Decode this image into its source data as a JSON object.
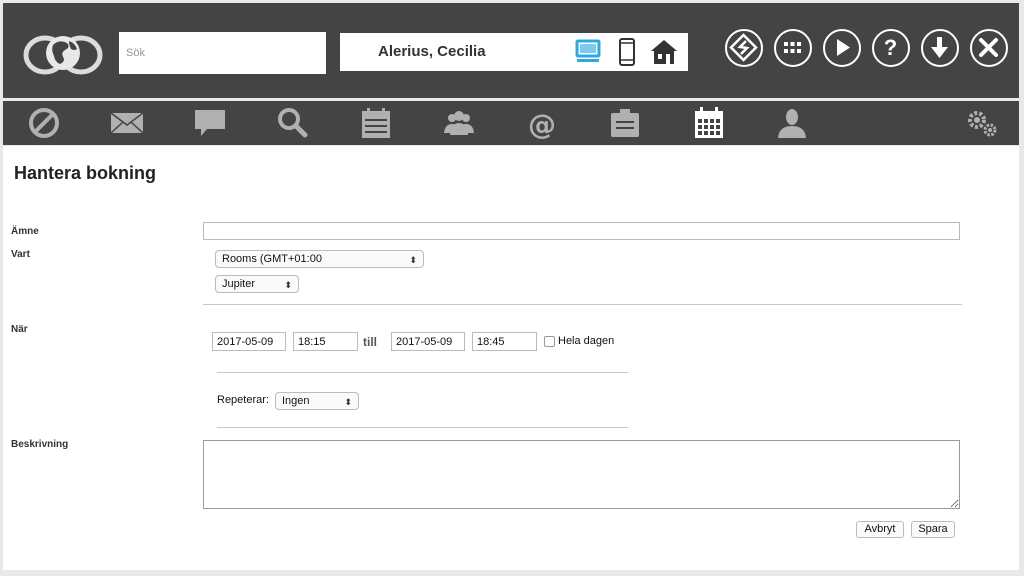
{
  "header": {
    "search_placeholder": "Sök",
    "user_name": "Alerius, Cecilia",
    "device_icons": [
      "desktop-icon",
      "phone-icon",
      "home-icon"
    ],
    "action_buttons": [
      "switch-icon",
      "apps-grid-icon",
      "play-icon",
      "help-icon",
      "download-icon",
      "close-icon"
    ]
  },
  "nav": {
    "items": [
      "block-icon",
      "mail-icon",
      "chat-icon",
      "search-icon",
      "calendar-list-icon",
      "group-icon",
      "at-icon",
      "clipboard-icon",
      "calendar-grid-icon",
      "person-icon",
      "settings-icon"
    ],
    "active": "calendar-grid-icon"
  },
  "form": {
    "title": "Hantera bokning",
    "subject_label": "Ämne",
    "subject_value": "",
    "where_label": "Vart",
    "location_select": "Rooms (GMT+01:00",
    "room_select": "Jupiter",
    "when_label": "När",
    "start_date": "2017-05-09",
    "start_time": "18:15",
    "till_label": "till",
    "end_date": "2017-05-09",
    "end_time": "18:45",
    "all_day_label": "Hela dagen",
    "all_day_checked": false,
    "repeat_label": "Repeterar:",
    "repeat_value": "Ingen",
    "description_label": "Beskrivning",
    "description_value": "",
    "cancel_label": "Avbryt",
    "save_label": "Spara"
  },
  "colors": {
    "header_bg": "#444444",
    "active_device": "#2fa8e0",
    "icon_grey": "#b0b0b0"
  }
}
